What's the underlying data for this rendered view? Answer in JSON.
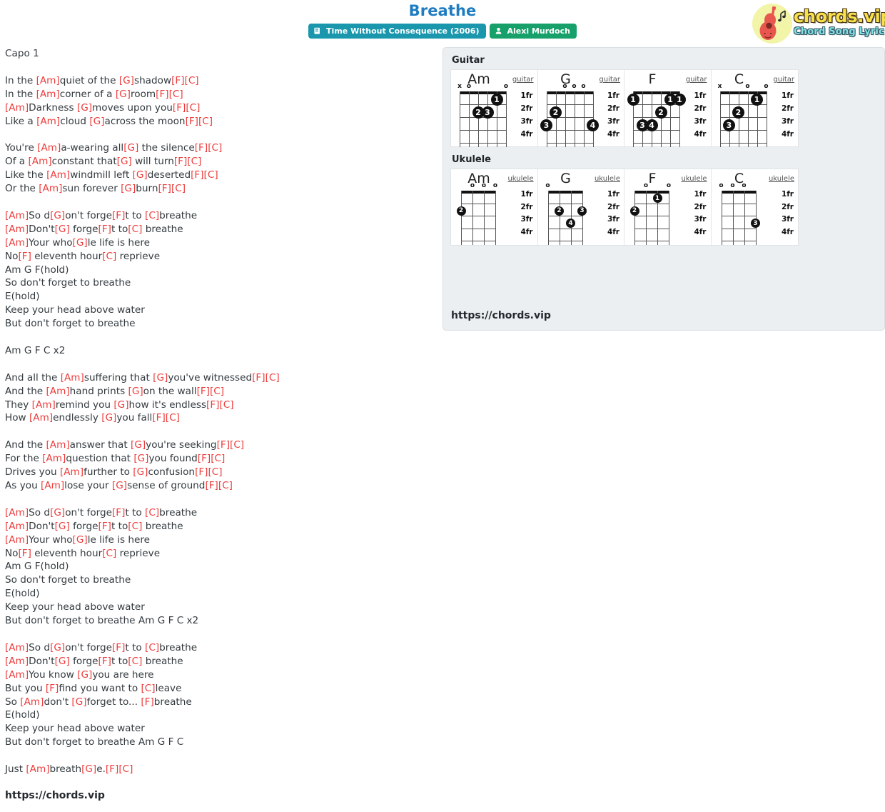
{
  "header": {
    "title": "Breathe",
    "album_badge": {
      "label": "Time Without Consequence (2006)",
      "icon": "album-icon",
      "color": "#1a97ad"
    },
    "artist_badge": {
      "label": "Alexi Murdoch",
      "icon": "user-icon",
      "color": "#18a06a"
    }
  },
  "logo": {
    "main": "chords.vip",
    "sub": "Chord Song Lyric",
    "icon": "guitar-icon"
  },
  "lyrics": {
    "capo": "Capo 1",
    "lines": [
      "Capo 1",
      "",
      "In the [Am]quiet of the [G]shadow[F][C]",
      "In the [Am]corner of a [G]room[F][C]",
      "[Am]Darkness [G]moves upon you[F][C]",
      "Like a [Am]cloud [G]across the moon[F][C]",
      "",
      "You're [Am]a-wearing all[G] the silence[F][C]",
      "Of a [Am]constant that[G] will turn[F][C]",
      "Like the [Am]windmill left [G]deserted[F][C]",
      "Or the [Am]sun forever [G]burn[F][C]",
      "",
      "[Am]So d[G]on't forge[F]t to [C]breathe",
      "[Am]Don't[G] forge[F]t to[C] breathe",
      "[Am]Your who[G]le life is here",
      "No[F] eleventh hour[C] reprieve",
      "Am G F(hold)",
      "So don't forget to breathe",
      "E(hold)",
      "Keep your head above water",
      "But don't forget to breathe",
      "",
      "Am G F C x2",
      "",
      "And all the [Am]suffering that [G]you've witnessed[F][C]",
      "And the [Am]hand prints [G]on the wall[F][C]",
      "They [Am]remind you [G]how it's endless[F][C]",
      "How [Am]endlessly [G]you fall[F][C]",
      "",
      "And the [Am]answer that [G]you're seeking[F][C]",
      "For the [Am]question that [G]you found[F][C]",
      "Drives you [Am]further to [G]confusion[F][C]",
      "As you [Am]lose your [G]sense of ground[F][C]",
      "",
      "[Am]So d[G]on't forge[F]t to [C]breathe",
      "[Am]Don't[G] forge[F]t to[C] breathe",
      "[Am]Your who[G]le life is here",
      "No[F] eleventh hour[C] reprieve",
      "Am G F(hold)",
      "So don't forget to breathe",
      "E(hold)",
      "Keep your head above water",
      "But don't forget to breathe Am G F C x2",
      "",
      "[Am]So d[G]on't forge[F]t to [C]breathe",
      "[Am]Don't[G] forge[F]t to[C] breathe",
      "[Am]You know [G]you are here",
      "But you [F]find you want to [C]leave",
      "So [Am]don't [G]forget to... [F]breathe",
      "E(hold)",
      "Keep your head above water",
      "But don't forget to breathe Am G F C",
      "",
      "Just [Am]breath[G]e.[F][C]"
    ],
    "footer_url": "https://chords.vip"
  },
  "chord_panel": {
    "guitar_label": "Guitar",
    "ukulele_label": "Ukulele",
    "url": "https://chords.vip",
    "fret_labels": [
      "1fr",
      "2fr",
      "3fr",
      "4fr"
    ],
    "guitar": [
      {
        "name": "Am",
        "instrument": "guitar",
        "strings": 6,
        "open_marks": [
          "x",
          "o",
          "",
          "",
          "",
          "o"
        ],
        "dots": [
          {
            "string": 2,
            "fret": 1,
            "finger": "1"
          },
          {
            "string": 4,
            "fret": 2,
            "finger": "2"
          },
          {
            "string": 3,
            "fret": 2,
            "finger": "3"
          }
        ]
      },
      {
        "name": "G",
        "instrument": "guitar",
        "strings": 6,
        "open_marks": [
          "",
          "",
          "o",
          "o",
          "o",
          ""
        ],
        "dots": [
          {
            "string": 5,
            "fret": 2,
            "finger": "2"
          },
          {
            "string": 6,
            "fret": 3,
            "finger": "3"
          },
          {
            "string": 1,
            "fret": 3,
            "finger": "4"
          }
        ]
      },
      {
        "name": "F",
        "instrument": "guitar",
        "strings": 6,
        "open_marks": [
          "",
          "",
          "",
          "",
          "",
          ""
        ],
        "dots": [
          {
            "string": 6,
            "fret": 1,
            "finger": "1"
          },
          {
            "string": 2,
            "fret": 1,
            "finger": "1"
          },
          {
            "string": 1,
            "fret": 1,
            "finger": "1"
          },
          {
            "string": 3,
            "fret": 2,
            "finger": "2"
          },
          {
            "string": 5,
            "fret": 3,
            "finger": "3"
          },
          {
            "string": 4,
            "fret": 3,
            "finger": "4"
          }
        ]
      },
      {
        "name": "C",
        "instrument": "guitar",
        "strings": 6,
        "open_marks": [
          "x",
          "",
          "",
          "o",
          "",
          "o"
        ],
        "dots": [
          {
            "string": 2,
            "fret": 1,
            "finger": "1"
          },
          {
            "string": 4,
            "fret": 2,
            "finger": "2"
          },
          {
            "string": 5,
            "fret": 3,
            "finger": "3"
          }
        ]
      }
    ],
    "ukulele": [
      {
        "name": "Am",
        "instrument": "ukulele",
        "strings": 4,
        "open_marks": [
          "",
          "o",
          "o",
          "o"
        ],
        "dots": [
          {
            "string": 4,
            "fret": 2,
            "finger": "2"
          }
        ]
      },
      {
        "name": "G",
        "instrument": "ukulele",
        "strings": 4,
        "open_marks": [
          "o",
          "",
          "",
          ""
        ],
        "dots": [
          {
            "string": 3,
            "fret": 2,
            "finger": "2"
          },
          {
            "string": 1,
            "fret": 2,
            "finger": "3"
          },
          {
            "string": 2,
            "fret": 3,
            "finger": "4"
          }
        ]
      },
      {
        "name": "F",
        "instrument": "ukulele",
        "strings": 4,
        "open_marks": [
          "",
          "o",
          "",
          "o"
        ],
        "dots": [
          {
            "string": 2,
            "fret": 1,
            "finger": "1"
          },
          {
            "string": 4,
            "fret": 2,
            "finger": "2"
          }
        ]
      },
      {
        "name": "C",
        "instrument": "ukulele",
        "strings": 4,
        "open_marks": [
          "o",
          "o",
          "o",
          ""
        ],
        "dots": [
          {
            "string": 1,
            "fret": 3,
            "finger": "3"
          }
        ]
      }
    ]
  }
}
